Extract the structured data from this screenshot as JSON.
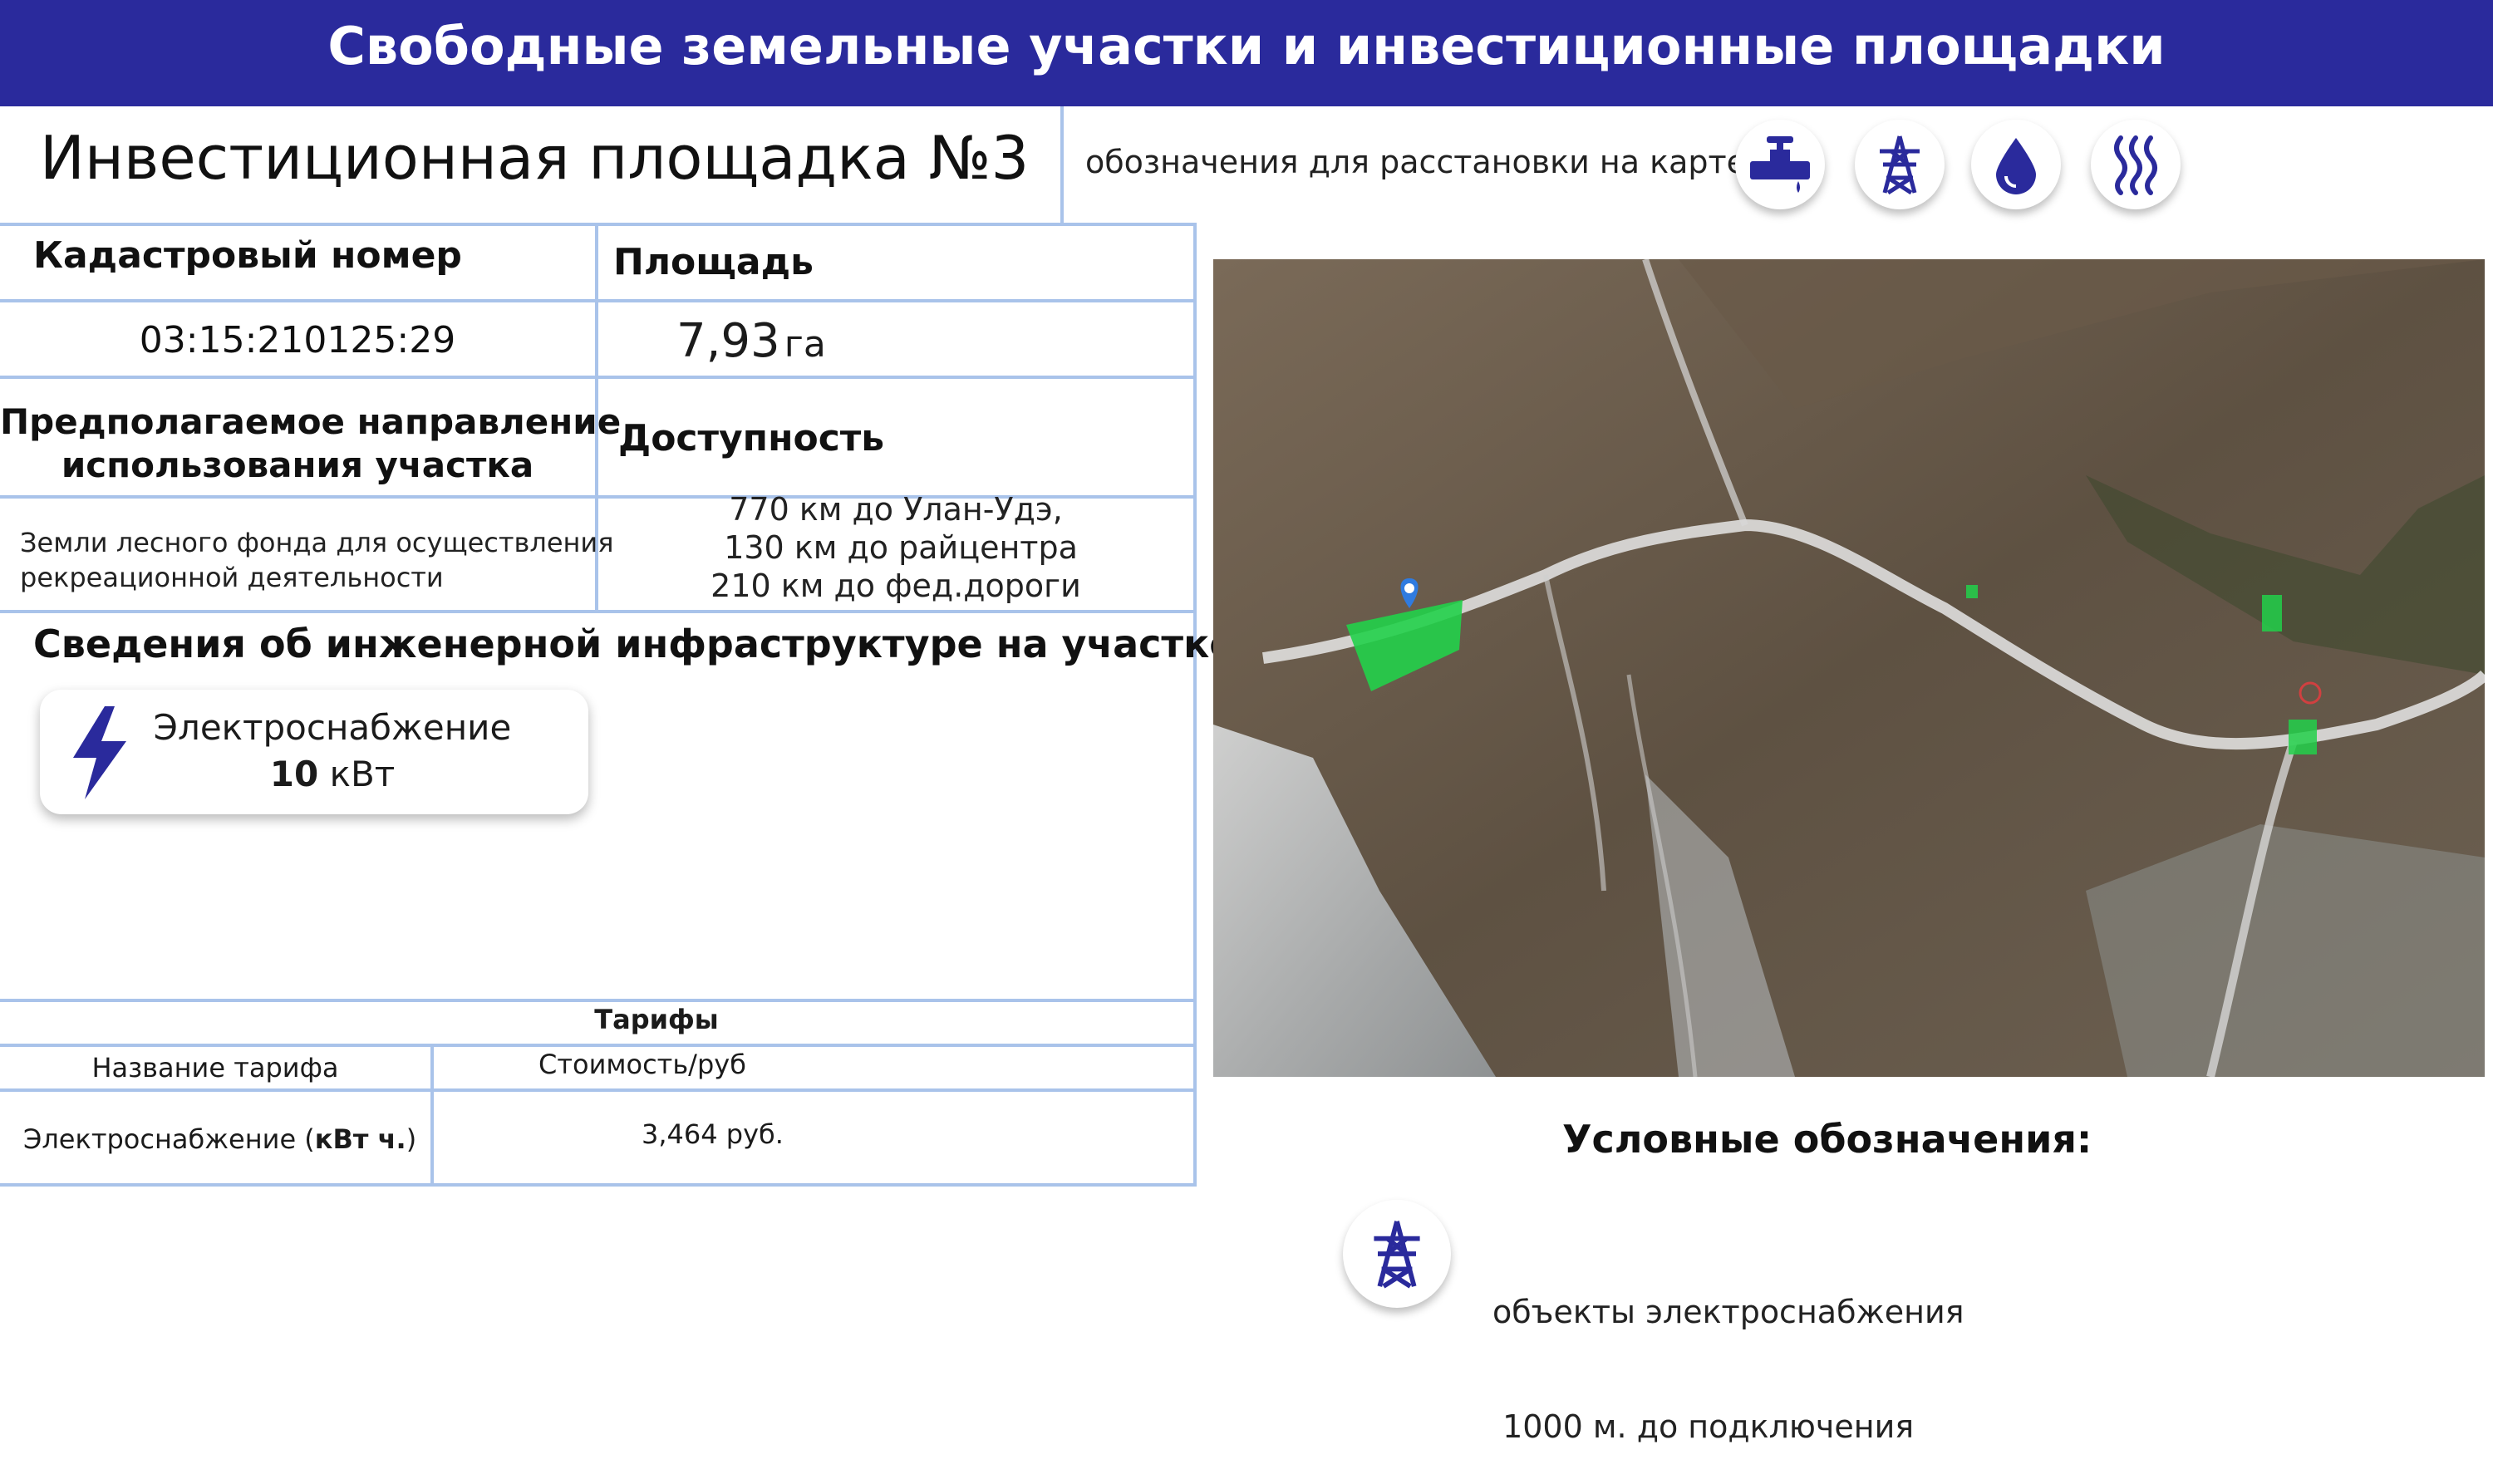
{
  "header": {
    "title": "Свободные земельные участки и инвестиционные площадки"
  },
  "site": {
    "title": "Инвестиционная площадка  №3"
  },
  "markers_legend": {
    "caption": "обозначения для расстановки на карте",
    "icons": [
      "pipeline-valve-icon",
      "power-tower-icon",
      "water-drop-icon",
      "heat-steam-icon"
    ],
    "accent_color": "#2a2a9c"
  },
  "info": {
    "cadastral_label": "Кадастровый номер",
    "cadastral_value": "03:15:210125:29",
    "area_label": "Площадь",
    "area_value": "7,93",
    "area_unit": "га",
    "usage_label_line1": "Предполагаемое направление",
    "usage_label_line2": "использования участка",
    "usage_value_line1": "Земли лесного фонда для осуществления",
    "usage_value_line2": "рекреационной деятельности",
    "access_label": "Доступность",
    "access_lines": [
      "770 км до Улан-Удэ,",
      " 130 км до райцентра",
      "210 км до фед.дороги"
    ]
  },
  "infrastructure": {
    "heading": "Сведения об инженерной инфраструктуре на участке:",
    "electricity": {
      "label": "Электроснабжение",
      "value": "10",
      "unit": "кВт",
      "icon": "lightning-icon"
    }
  },
  "tariffs": {
    "title": "Тарифы",
    "col_name": "Название тарифа",
    "col_cost": "Стоимость/руб",
    "row_name": "Электроснабжение (",
    "row_unit": "кВт ч.",
    "row_close": ")",
    "row_cost": "3,464 руб."
  },
  "legend": {
    "heading": "Условные обозначения:",
    "item_line1": "объекты электроснабжения",
    "item_line2": " 1000 м. до подключения",
    "item_icon": "power-tower-icon"
  },
  "map": {
    "type": "satellite-image",
    "plot_color": "#22d04a",
    "pin_color": "#2f7be0"
  }
}
